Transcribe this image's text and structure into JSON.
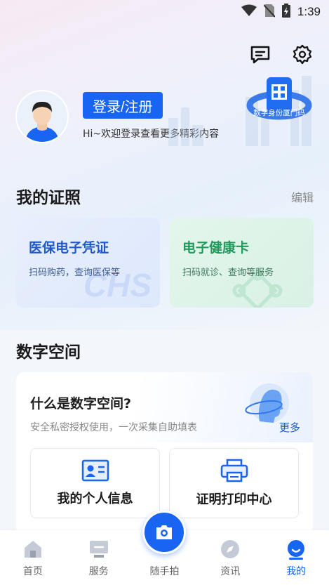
{
  "status_bar": {
    "time": "1:39"
  },
  "profile": {
    "login_label": "登录/注册",
    "welcome_text": "Hi~欢迎登录查看更多精彩内容",
    "badge_text": "数字身份厦门码"
  },
  "licenses": {
    "title": "我的证照",
    "edit_label": "编辑",
    "cards": [
      {
        "title": "医保电子凭证",
        "subtitle": "扫码购药，查询医保等",
        "watermark": "CHS"
      },
      {
        "title": "电子健康卡",
        "subtitle": "扫码就诊、查询等服务"
      }
    ]
  },
  "digital_space": {
    "title": "数字空间",
    "question": "什么是数字空间?",
    "description": "安全私密授权使用，一次采集自助填表",
    "more_label": "更多",
    "tiles": [
      {
        "label": "我的个人信息",
        "icon": "id-card-icon"
      },
      {
        "label": "证明打印中心",
        "icon": "printer-icon"
      }
    ]
  },
  "tabbar": {
    "items": [
      {
        "label": "首页",
        "icon": "home-icon"
      },
      {
        "label": "服务",
        "icon": "service-icon"
      },
      {
        "label": "随手拍",
        "icon": "camera-icon"
      },
      {
        "label": "资讯",
        "icon": "compass-icon"
      },
      {
        "label": "我的",
        "icon": "profile-icon",
        "active": true
      }
    ]
  },
  "colors": {
    "accent": "#1765f2",
    "green": "#1f9a5a"
  }
}
